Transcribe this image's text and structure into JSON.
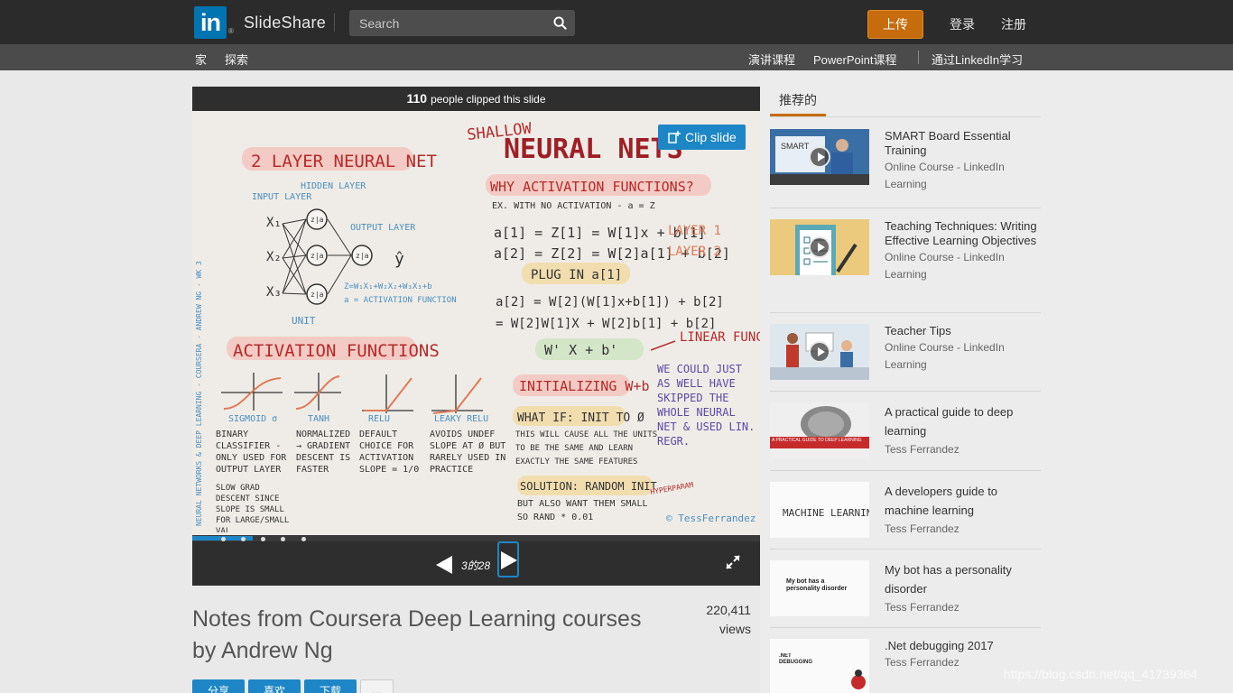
{
  "header": {
    "logo_text": "in",
    "logo_reg": "®",
    "brand": "SlideShare",
    "search_placeholder": "Search",
    "upload": "上传",
    "login": "登录",
    "register": "注册"
  },
  "subnav": {
    "home": "家",
    "explore": "探索",
    "speech_course": "演讲课程",
    "ppt_course": "PowerPoint课程",
    "linkedin_learning": "通过LinkedIn学习"
  },
  "player": {
    "clip_count": "110",
    "clip_text": "people clipped this slide",
    "clip_button": "Clip slide",
    "page_indicator": "3的28",
    "progress_fraction": 0.107,
    "slide": {
      "title_small": "SHALLOW",
      "title_big": "NEURAL NETS",
      "layer_heading": "2 LAYER NEURAL NET",
      "input_layer": "INPUT LAYER",
      "hidden_layer": "HIDDEN LAYER",
      "output_layer": "OUTPUT LAYER",
      "unit": "UNIT",
      "z_formula": "Z=W₁X₁+W₂X₂+W₃X₃+b",
      "a_formula": "a = ACTIVATION FUNCTION",
      "why_activation": "WHY ACTIVATION FUNCTIONS?",
      "ex_no_activation": "EX. WITH NO ACTIVATION - a = Z",
      "eq1": "a[1] = Z[1] = W[1]x + b[1]",
      "eq2": "a[2] = Z[2] = W[2]a[1] + b[2]",
      "layer1": "LAYER 1",
      "layer2": "LAYER 2",
      "plug_in": "PLUG IN a[1]",
      "eq3": "a[2] = W[2](W[1]x+b[1]) + b[2]",
      "eq4": "= W[2]W[1]X + W[2]b[1] + b[2]",
      "linear_result": "W' X + b'",
      "linear_function": "LINEAR FUNCTION",
      "activation_functions": "ACTIVATION FUNCTIONS",
      "sigmoid": "SIGMOID σ",
      "tanh": "TANH",
      "relu": "RELU",
      "leaky_relu": "LEAKY RELU",
      "sigmoid_desc": "BINARY CLASSIFIER - ONLY USED FOR OUTPUT LAYER",
      "sigmoid_desc2": "SLOW GRAD DESCENT SINCE SLOPE IS SMALL FOR LARGE/SMALL VAL",
      "tanh_desc": "NORMALIZED → GRADIENT DESCENT IS FASTER",
      "relu_desc": "DEFAULT CHOICE FOR ACTIVATION SLOPE = 1/0",
      "leaky_desc": "AVOIDS UNDEF SLOPE AT Ø BUT RARELY USED IN PRACTICE",
      "initializing": "INITIALIZING W+b",
      "what_if": "WHAT IF: INIT TO Ø",
      "init_desc": "THIS WILL CAUSE ALL THE UNITS TO BE THE SAME AND LEARN EXACTLY THE SAME FEATURES",
      "solution": "SOLUTION: RANDOM INIT",
      "small_rand": "BUT ALSO WANT THEM SMALL SO RAND * 0.01",
      "hyperparam": "HYPERPARAM",
      "we_could": "WE COULD JUST AS WELL HAVE SKIPPED THE WHOLE NEURAL NET & USED LIN. REGR.",
      "side_credit": "NEURAL NETWORKS & DEEP LEARNING - COURSERA - ANDREW NG - WK 3",
      "signature": "© TessFerrandez"
    }
  },
  "main": {
    "title": "Notes from Coursera Deep Learning courses by Andrew Ng",
    "views_number": "220,411",
    "views_label": "views",
    "share": "分享",
    "like": "喜欢",
    "download": "下载",
    "more": "..."
  },
  "sidebar": {
    "tab": "推荐的",
    "items": [
      {
        "title": "SMART Board Essential Training",
        "sub": "Online Course - LinkedIn Learning"
      },
      {
        "title": "Teaching Techniques: Writing Effective Learning Objectives",
        "sub": "Online Course - LinkedIn Learning"
      },
      {
        "title": "Teacher Tips",
        "sub": "Online Course - LinkedIn Learning"
      },
      {
        "title": "A practical guide to deep learning",
        "sub": "Tess Ferrandez"
      },
      {
        "title": "A developers guide to machine learning",
        "sub": "Tess Ferrandez"
      },
      {
        "title": "My bot has a personality disorder",
        "sub": "Tess Ferrandez"
      },
      {
        "title": ".Net debugging 2017",
        "sub": "Tess Ferrandez"
      }
    ],
    "thumb_texts": {
      "smart": "SMART",
      "deep_learning": "A PRACTICAL GUIDE TO DEEP LEARNING",
      "ml": "MACHINE LEARNING",
      "bot": "My bot has a personality disorder",
      "net": ".NET DEBUGGING"
    }
  },
  "watermark": "https://blog.csdn.net/qq_41739364",
  "colors": {
    "brand_blue": "#0073b1",
    "clip_blue": "#1d86c6",
    "upload_orange": "#c66c0d",
    "slide_red": "#b52a2a",
    "slide_orange": "#e07a58"
  }
}
